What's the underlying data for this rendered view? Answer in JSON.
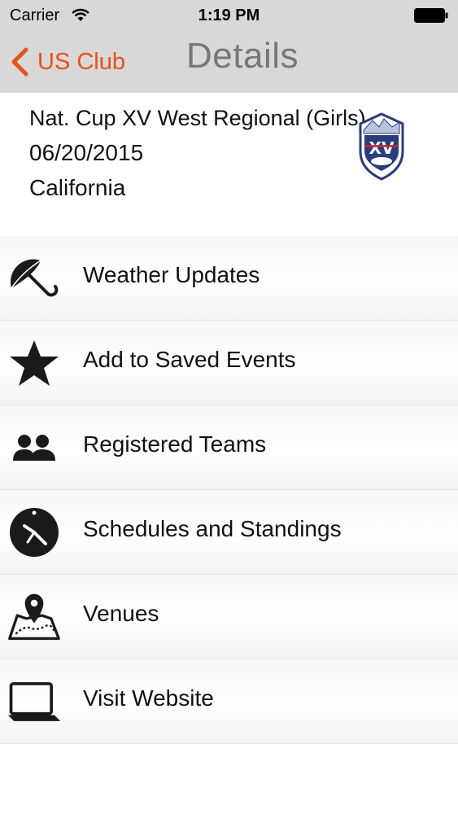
{
  "status_bar": {
    "carrier": "Carrier",
    "time": "1:19 PM"
  },
  "nav": {
    "back_label": "US Club",
    "title": "Details"
  },
  "event": {
    "name": "Nat. Cup XV West Regional (Girls)",
    "date": "06/20/2015",
    "state": "California",
    "logo_text": "XV"
  },
  "menu": {
    "items": [
      {
        "label": "Weather Updates",
        "icon": "umbrella-icon"
      },
      {
        "label": "Add to Saved Events",
        "icon": "star-icon"
      },
      {
        "label": "Registered Teams",
        "icon": "people-icon"
      },
      {
        "label": "Schedules and Standings",
        "icon": "clock-icon"
      },
      {
        "label": "Venues",
        "icon": "map-pin-icon"
      },
      {
        "label": "Visit Website",
        "icon": "laptop-icon"
      }
    ]
  },
  "colors": {
    "accent": "#e8501c",
    "nav_background": "#d8d8d8",
    "nav_title": "#777777"
  }
}
